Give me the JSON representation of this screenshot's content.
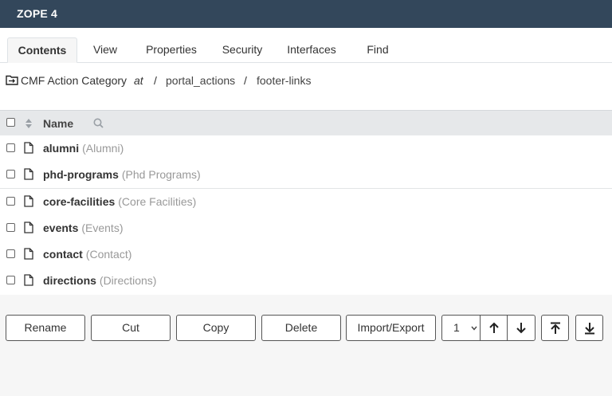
{
  "app": {
    "brand": "ZOPE 4"
  },
  "tabs": [
    {
      "label": "Contents",
      "active": true
    },
    {
      "label": "View"
    },
    {
      "label": "Properties"
    },
    {
      "label": "Security"
    },
    {
      "label": "Interfaces"
    },
    {
      "label": "Find"
    }
  ],
  "breadcrumb": {
    "type_label": "CMF Action Category",
    "at": "at",
    "sep": "/",
    "path": [
      "portal_actions",
      "footer-links"
    ]
  },
  "table": {
    "column_name": "Name",
    "rows": [
      {
        "id": "alumni",
        "title": "(Alumni)"
      },
      {
        "id": "phd-programs",
        "title": "(Phd Programs)"
      },
      {
        "id": "core-facilities",
        "title": "(Core Facilities)"
      },
      {
        "id": "events",
        "title": "(Events)"
      },
      {
        "id": "contact",
        "title": "(Contact)"
      },
      {
        "id": "directions",
        "title": "(Directions)"
      }
    ]
  },
  "actions": {
    "rename": "Rename",
    "cut": "Cut",
    "copy": "Copy",
    "delete": "Delete",
    "import_export": "Import/Export",
    "move_amount": "1"
  },
  "icons": {
    "folder": "folder-icon",
    "document": "document-icon",
    "sort": "sort-icon",
    "search": "search-icon",
    "up": "arrow-up-icon",
    "down": "arrow-down-icon",
    "top": "arrow-to-top-icon",
    "bottom": "arrow-to-bottom-icon",
    "chevron": "chevron-down-icon"
  },
  "colors": {
    "topbar": "#33475b",
    "table_head": "#e6e8ea"
  }
}
